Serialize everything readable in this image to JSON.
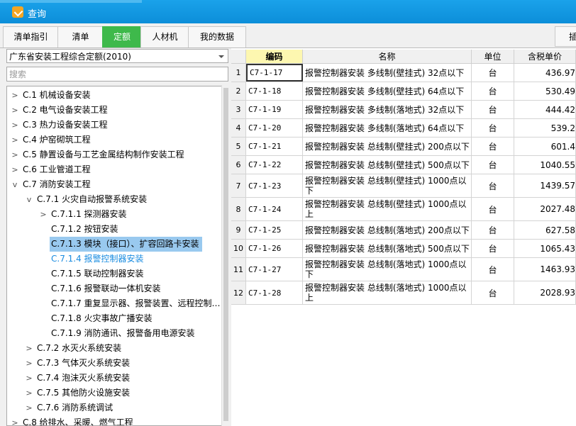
{
  "window": {
    "title": "查询"
  },
  "tabs": [
    {
      "label": "清单指引"
    },
    {
      "label": "清单"
    },
    {
      "label": "定额"
    },
    {
      "label": "人材机"
    },
    {
      "label": "我的数据"
    }
  ],
  "tab_right_label": "插",
  "left": {
    "quota_select": "广东省安装工程综合定额(2010)",
    "search_placeholder": "搜索",
    "tree": [
      {
        "text": "C.1 机械设备安装"
      },
      {
        "text": "C.2 电气设备安装工程"
      },
      {
        "text": "C.3 热力设备安装工程"
      },
      {
        "text": "C.4 炉窑砌筑工程"
      },
      {
        "text": "C.5 静置设备与工艺金属结构制作安装工程"
      },
      {
        "text": "C.6 工业管道工程"
      },
      {
        "text": "C.7 消防安装工程"
      },
      {
        "text": "C.7.1 火灾自动报警系统安装"
      },
      {
        "text": "C.7.1.1 探测器安装"
      },
      {
        "text": "C.7.1.2 按钮安装"
      },
      {
        "text": "C.7.1.3 模块（接口）、扩容回路卡安装"
      },
      {
        "text": "C.7.1.4 报警控制器安装"
      },
      {
        "text": "C.7.1.5 联动控制器安装"
      },
      {
        "text": "C.7.1.6 报警联动一体机安装"
      },
      {
        "text": "C.7.1.7 重复显示器、报警装置、远程控制…"
      },
      {
        "text": "C.7.1.8 火灾事故广播安装"
      },
      {
        "text": "C.7.1.9 消防通讯、报警备用电源安装"
      },
      {
        "text": "C.7.2 水灭火系统安装"
      },
      {
        "text": "C.7.3 气体灭火系统安装"
      },
      {
        "text": "C.7.4 泡沫灭火系统安装"
      },
      {
        "text": "C.7.5 其他防火设施安装"
      },
      {
        "text": "C.7.6 消防系统调试"
      },
      {
        "text": "C.8 给排水、采暖、燃气工程"
      }
    ]
  },
  "table": {
    "headers": {
      "code": "编码",
      "name": "名称",
      "unit": "单位",
      "price": "含税单价"
    },
    "rows": [
      {
        "no": "1",
        "code": "C7-1-17",
        "name": "报警控制器安装 多线制(壁挂式) 32点以下",
        "unit": "台",
        "price": "436.97"
      },
      {
        "no": "2",
        "code": "C7-1-18",
        "name": "报警控制器安装 多线制(壁挂式) 64点以下",
        "unit": "台",
        "price": "530.49"
      },
      {
        "no": "3",
        "code": "C7-1-19",
        "name": "报警控制器安装 多线制(落地式) 32点以下",
        "unit": "台",
        "price": "444.42"
      },
      {
        "no": "4",
        "code": "C7-1-20",
        "name": "报警控制器安装 多线制(落地式) 64点以下",
        "unit": "台",
        "price": "539.2"
      },
      {
        "no": "5",
        "code": "C7-1-21",
        "name": "报警控制器安装 总线制(壁挂式) 200点以下",
        "unit": "台",
        "price": "601.4"
      },
      {
        "no": "6",
        "code": "C7-1-22",
        "name": "报警控制器安装 总线制(壁挂式) 500点以下",
        "unit": "台",
        "price": "1040.55"
      },
      {
        "no": "7",
        "code": "C7-1-23",
        "name": "报警控制器安装 总线制(壁挂式) 1000点以下",
        "unit": "台",
        "price": "1439.57"
      },
      {
        "no": "8",
        "code": "C7-1-24",
        "name": "报警控制器安装 总线制(壁挂式) 1000点以上",
        "unit": "台",
        "price": "2027.48"
      },
      {
        "no": "9",
        "code": "C7-1-25",
        "name": "报警控制器安装 总线制(落地式) 200点以下",
        "unit": "台",
        "price": "627.58"
      },
      {
        "no": "10",
        "code": "C7-1-26",
        "name": "报警控制器安装 总线制(落地式) 500点以下",
        "unit": "台",
        "price": "1065.43"
      },
      {
        "no": "11",
        "code": "C7-1-27",
        "name": "报警控制器安装 总线制(落地式) 1000点以下",
        "unit": "台",
        "price": "1463.93"
      },
      {
        "no": "12",
        "code": "C7-1-28",
        "name": "报警控制器安装 总线制(落地式) 1000点以上",
        "unit": "台",
        "price": "2028.93"
      }
    ]
  }
}
